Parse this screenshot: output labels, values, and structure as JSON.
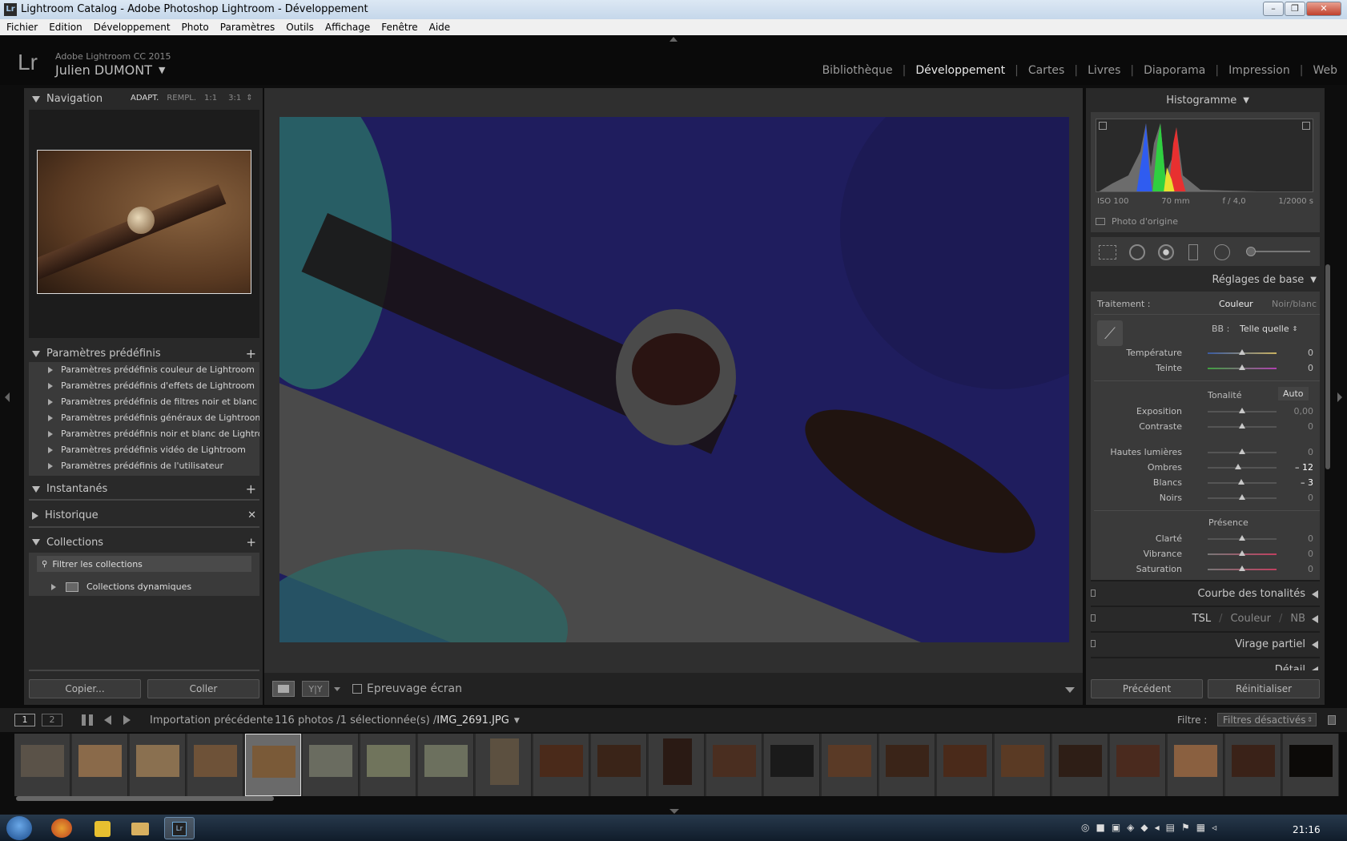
{
  "window": {
    "title": "Lightroom Catalog - Adobe Photoshop Lightroom - Développement",
    "app_icon": "Lr"
  },
  "menu": [
    "Fichier",
    "Edition",
    "Développement",
    "Photo",
    "Paramètres",
    "Outils",
    "Affichage",
    "Fenêtre",
    "Aide"
  ],
  "identity": {
    "logo": "Lr",
    "product": "Adobe Lightroom CC 2015",
    "user": "Julien DUMONT"
  },
  "modules": [
    {
      "label": "Bibliothèque",
      "active": false
    },
    {
      "label": "Développement",
      "active": true
    },
    {
      "label": "Cartes",
      "active": false
    },
    {
      "label": "Livres",
      "active": false
    },
    {
      "label": "Diaporama",
      "active": false
    },
    {
      "label": "Impression",
      "active": false
    },
    {
      "label": "Web",
      "active": false
    }
  ],
  "left": {
    "navigation": {
      "title": "Navigation",
      "zoom": [
        "ADAPT.",
        "REMPL.",
        "1:1",
        "3:1"
      ]
    },
    "presets": {
      "title": "Paramètres prédéfinis",
      "items": [
        "Paramètres prédéfinis couleur de Lightroom",
        "Paramètres prédéfinis d'effets de Lightroom",
        "Paramètres prédéfinis de filtres noir et blanc d...",
        "Paramètres prédéfinis généraux de Lightroom",
        "Paramètres prédéfinis noir et blanc de Lightro...",
        "Paramètres prédéfinis vidéo de Lightroom",
        "Paramètres prédéfinis de l'utilisateur"
      ]
    },
    "snapshots": "Instantanés",
    "history": "Historique",
    "collections": {
      "title": "Collections",
      "filter_placeholder": "Filtrer les collections",
      "item": "Collections dynamiques"
    },
    "copy_button": "Copier...",
    "paste_button": "Coller"
  },
  "toolbar": {
    "proof_label": "Epreuvage écran",
    "compare": "Y|Y"
  },
  "right": {
    "histogram": {
      "title": "Histogramme",
      "iso": "ISO 100",
      "focal": "70 mm",
      "aperture": "f / 4,0",
      "shutter": "1/2000 s",
      "original": "Photo d'origine"
    },
    "basic": {
      "title": "Réglages de base",
      "treatment_label": "Traitement :",
      "treatment_color": "Couleur",
      "treatment_bw": "Noir/blanc",
      "wb_label": "BB :",
      "wb_value": "Telle quelle",
      "tone_label": "Tonalité",
      "auto": "Auto",
      "presence_label": "Présence",
      "sliders": {
        "temperature": {
          "label": "Température",
          "value": "0",
          "pos": 0.5
        },
        "tint": {
          "label": "Teinte",
          "value": "0",
          "pos": 0.5
        },
        "exposure": {
          "label": "Exposition",
          "value": "0,00",
          "pos": 0.5
        },
        "contrast": {
          "label": "Contraste",
          "value": "0",
          "pos": 0.5
        },
        "highlights": {
          "label": "Hautes lumières",
          "value": "0",
          "pos": 0.5
        },
        "shadows": {
          "label": "Ombres",
          "value": "– 12",
          "pos": 0.44
        },
        "whites": {
          "label": "Blancs",
          "value": "– 3",
          "pos": 0.485
        },
        "blacks": {
          "label": "Noirs",
          "value": "0",
          "pos": 0.5
        },
        "clarity": {
          "label": "Clarté",
          "value": "0",
          "pos": 0.5
        },
        "vibrance": {
          "label": "Vibrance",
          "value": "0",
          "pos": 0.5
        },
        "saturation": {
          "label": "Saturation",
          "value": "0",
          "pos": 0.5
        }
      }
    },
    "tone_curve": "Courbe des tonalités",
    "hsl": {
      "a": "TSL",
      "sep1": "/",
      "b": "Couleur",
      "sep2": "/",
      "c": "NB"
    },
    "split_toning": "Virage partiel",
    "detail": "Détail",
    "previous_button": "Précédent",
    "reset_button": "Réinitialiser"
  },
  "filmstrip": {
    "view1": "1",
    "view2": "2",
    "source": "Importation précédente",
    "count": "116 photos /1 sélectionnée(s) /",
    "file": "IMG_2691.JPG",
    "filter_label": "Filtre :",
    "filter_value": "Filtres désactivés",
    "thumb_colors": [
      "#5a5248",
      "#8a6a4a",
      "#8a7050",
      "#6e5238",
      "#7a5a38",
      "#6a6c60",
      "#70745c",
      "#6c705e",
      "#5c5040",
      "#4a2a1a",
      "#3a2418",
      "#2a1a14",
      "#4a2e20",
      "#1a1a1a",
      "#5a3a26",
      "#3a2418",
      "#4a2a1a",
      "#5a3a24",
      "#2e1e16",
      "#4a2a1e",
      "#8a6040",
      "#3a2218",
      "#0c0a08"
    ]
  },
  "taskbar": {
    "time": "21:16"
  }
}
